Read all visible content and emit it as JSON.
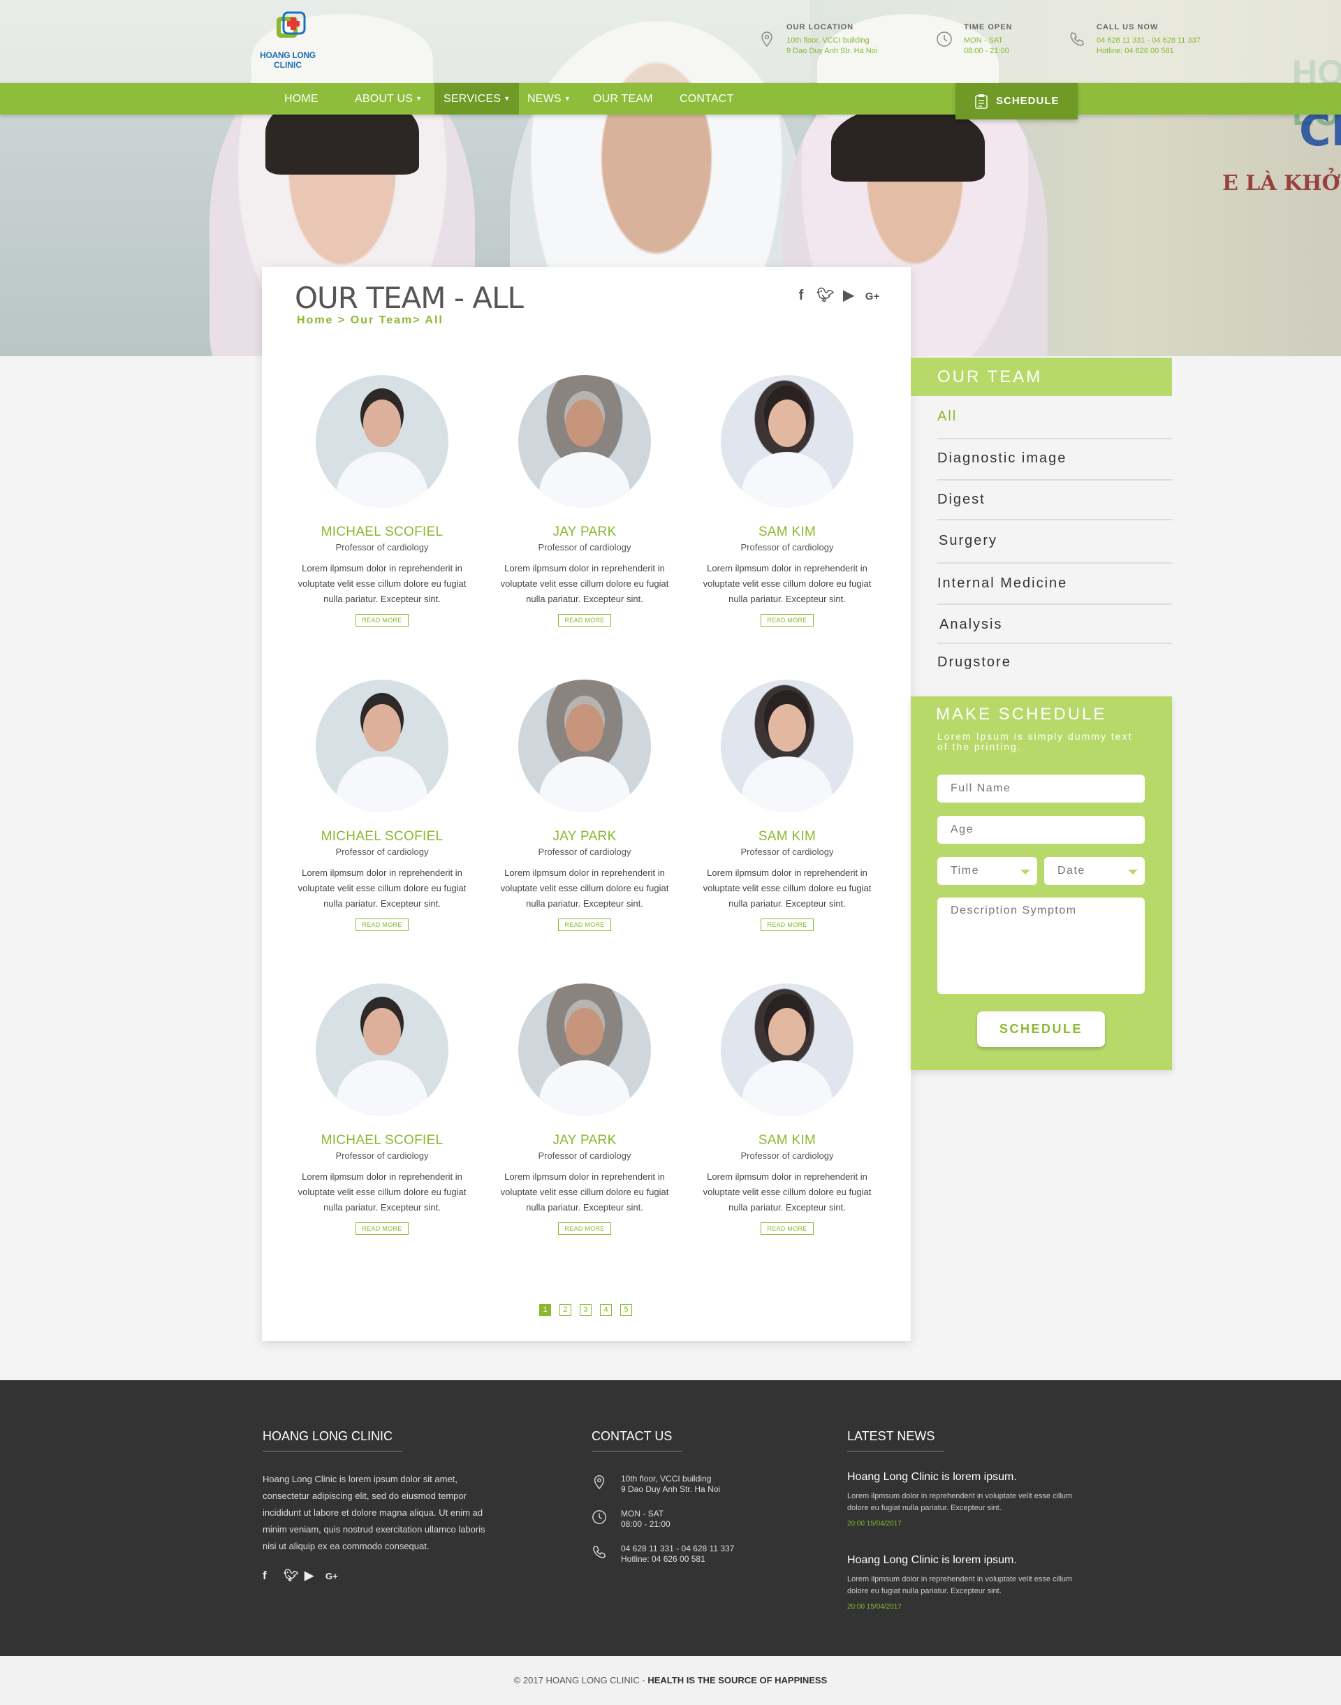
{
  "header": {
    "logo_line1": "HOANG LONG",
    "logo_line2": "CLINIC",
    "location": {
      "label": "OUR LOCATION",
      "line1": "10th floor, VCCI building",
      "line2": "9 Dao Duy Anh Str. Ha Noi"
    },
    "time": {
      "label": "TIME OPEN",
      "line1": "MON - SAT",
      "line2": "08:00 - 21:00"
    },
    "call": {
      "label": "CALL US NOW",
      "line1": "04 628 11 331 - 04 628 11 337",
      "line2": "Hotline:  04 626 00 581"
    },
    "hero_sign": {
      "line0": "HOANG LONG",
      "line1": "CLINIC",
      "line2": "E LÀ KHỞI NGUỒN CỦA HẠNH PHÚC"
    }
  },
  "nav": {
    "items": [
      {
        "label": "HOME"
      },
      {
        "label": "ABOUT US"
      },
      {
        "label": "SERVICES"
      },
      {
        "label": "NEWS"
      },
      {
        "label": "OUR TEAM"
      },
      {
        "label": "CONTACT"
      }
    ],
    "schedule_label": "SCHEDULE"
  },
  "page": {
    "title": "OUR TEAM - ALL",
    "breadcrumb": "Home > Our Team> All",
    "socials": [
      "facebook-icon",
      "twitter-icon",
      "youtube-icon",
      "google-plus-icon"
    ]
  },
  "members": [
    {
      "name": "MICHAEL SCOFIEL",
      "role": "Professor of cardiology",
      "desc": "Lorem ilpmsum dolor in reprehenderit in voluptate velit esse cillum dolore eu fugiat nulla pariatur. Excepteur sint.",
      "btn": "READ MORE"
    },
    {
      "name": "JAY PARK",
      "role": "Professor of cardiology",
      "desc": "Lorem ilpmsum dolor in reprehenderit in voluptate velit esse cillum dolore eu fugiat nulla pariatur. Excepteur sint.",
      "btn": "READ MORE"
    },
    {
      "name": "SAM KIM",
      "role": "Professor of cardiology",
      "desc": "Lorem ilpmsum dolor in reprehenderit in voluptate velit esse cillum dolore eu fugiat nulla pariatur. Excepteur sint.",
      "btn": "READ MORE"
    },
    {
      "name": "MICHAEL SCOFIEL",
      "role": "Professor of cardiology",
      "desc": "Lorem ilpmsum dolor in reprehenderit in voluptate velit esse cillum dolore eu fugiat nulla pariatur. Excepteur sint.",
      "btn": "READ MORE"
    },
    {
      "name": "JAY PARK",
      "role": "Professor of cardiology",
      "desc": "Lorem ilpmsum dolor in reprehenderit in voluptate velit esse cillum dolore eu fugiat nulla pariatur. Excepteur sint.",
      "btn": "READ MORE"
    },
    {
      "name": "SAM KIM",
      "role": "Professor of cardiology",
      "desc": "Lorem ilpmsum dolor in reprehenderit in voluptate velit esse cillum dolore eu fugiat nulla pariatur. Excepteur sint.",
      "btn": "READ MORE"
    },
    {
      "name": "MICHAEL SCOFIEL",
      "role": "Professor of cardiology",
      "desc": "Lorem ilpmsum dolor in reprehenderit in voluptate velit esse cillum dolore eu fugiat nulla pariatur. Excepteur sint.",
      "btn": "READ MORE"
    },
    {
      "name": "JAY PARK",
      "role": "Professor of cardiology",
      "desc": "Lorem ilpmsum dolor in reprehenderit in voluptate velit esse cillum dolore eu fugiat nulla pariatur. Excepteur sint.",
      "btn": "READ MORE"
    },
    {
      "name": "SAM KIM",
      "role": "Professor of cardiology",
      "desc": "Lorem ilpmsum dolor in reprehenderit in voluptate velit esse cillum dolore eu fugiat nulla pariatur. Excepteur sint.",
      "btn": "READ MORE"
    }
  ],
  "pagination": [
    "1",
    "2",
    "3",
    "4",
    "5"
  ],
  "sidebar": {
    "title": "OUR TEAM",
    "items": [
      {
        "label": "All"
      },
      {
        "label": "Diagnostic image"
      },
      {
        "label": "Digest"
      },
      {
        "label": "Surgery"
      },
      {
        "label": "Internal Medicine"
      },
      {
        "label": "Analysis"
      },
      {
        "label": "Drugstore"
      }
    ]
  },
  "form": {
    "title": "MAKE SCHEDULE",
    "subtitle": "Lorem Ipsum is simply dummy text of the printing.",
    "full_name": "Full Name",
    "age": "Age",
    "time": "Time",
    "date": "Date",
    "symptom": "Description Symptom",
    "submit": "SCHEDULE"
  },
  "footer": {
    "about_title": "HOANG LONG CLINIC",
    "about_text": "Hoang Long Clinic is lorem ipsum dolor sit amet, consectetur adipiscing elit, sed do eiusmod tempor incididunt ut labore et dolore magna aliqua. Ut enim ad minim veniam, quis nostrud exercitation ullamco laboris nisi ut aliquip ex ea commodo consequat.",
    "contact_title": "CONTACT US",
    "contact": {
      "addr1": "10th floor, VCCI building",
      "addr2": "9 Dao Duy Anh Str. Ha Noi",
      "time1": "MON - SAT",
      "time2": "08:00 - 21:00",
      "phone1": "04 628 11 331 - 04 628 11 337",
      "phone2": "Hotline:  04 626 00 581"
    },
    "news_title": "LATEST NEWS",
    "news": [
      {
        "title": "Hoang Long Clinic is lorem ipsum.",
        "desc": "Lorem ilpmsum dolor in reprehenderit in voluptate velit esse cillum dolore eu fugiat nulla pariatur. Excepteur sint.",
        "date": "20:00 15/04/2017"
      },
      {
        "title": "Hoang Long Clinic is lorem ipsum.",
        "desc": "Lorem ilpmsum dolor in reprehenderit in voluptate velit esse cillum dolore eu fugiat nulla pariatur. Excepteur sint.",
        "date": "20:00 15/04/2017"
      }
    ]
  },
  "copyright": {
    "prefix": "© 2017  HOANG LONG CLINIC - ",
    "slogan": "HEALTH IS THE SOURCE OF HAPPINESS"
  },
  "colors": {
    "accent": "#8bb82f",
    "accent_dark": "#6f9a25",
    "sidebar_green": "#b7d96a",
    "footer_bg": "#333333"
  }
}
